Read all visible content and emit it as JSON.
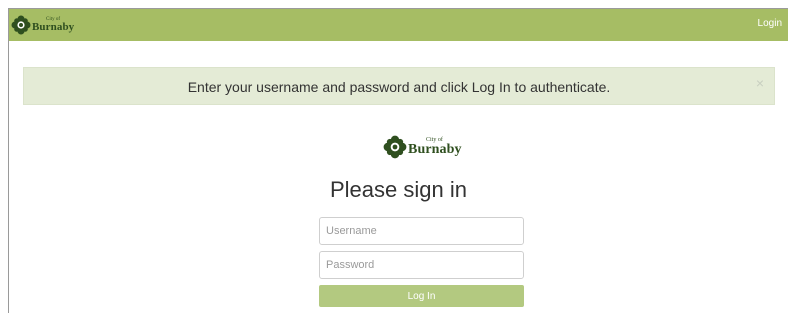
{
  "brand": {
    "logo_small": "City of",
    "logo_big": "Burnaby"
  },
  "header": {
    "login_link": "Login"
  },
  "alert": {
    "message": "Enter your username and password and click Log In to authenticate.",
    "close_symbol": "×"
  },
  "form": {
    "title": "Please sign in",
    "username_placeholder": "Username",
    "password_placeholder": "Password",
    "submit_label": "Log In"
  },
  "colors": {
    "header_bar": "#a6bd64",
    "alert_bg": "#e4ebd6",
    "button_bg": "#b3c980",
    "logo_green": "#2f4f1f"
  },
  "icons": {
    "logo_mark": "flower-icon",
    "alert_close": "close-icon"
  }
}
